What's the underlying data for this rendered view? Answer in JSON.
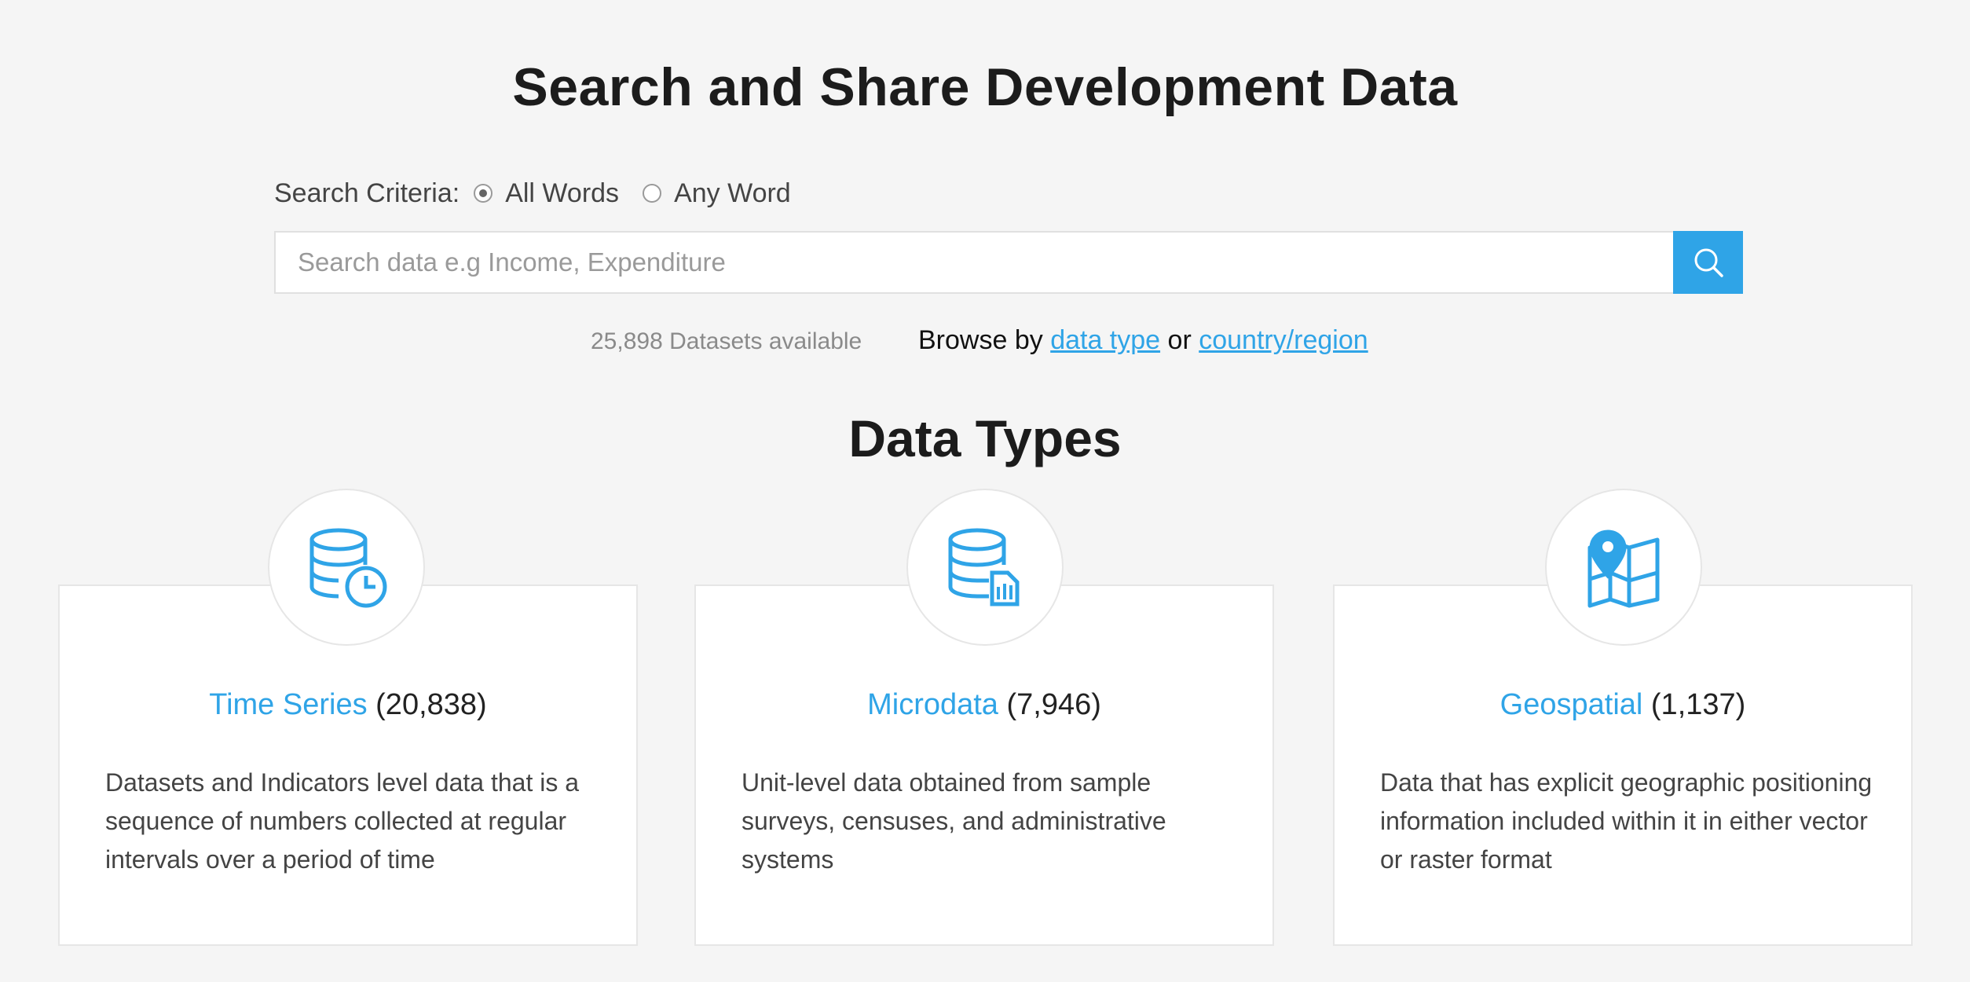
{
  "header": {
    "title": "Search and Share Development Data"
  },
  "search": {
    "criteria_label": "Search Criteria:",
    "options": [
      {
        "label": "All Words",
        "checked": true
      },
      {
        "label": "Any Word",
        "checked": false
      }
    ],
    "placeholder": "Search data e.g Income, Expenditure",
    "value": "",
    "button_icon": "search-icon"
  },
  "info": {
    "dataset_count": "25,898 Datasets available",
    "browse_prefix": "Browse by",
    "link_data_type": "data type",
    "browse_or": "or",
    "link_country_region": "country/region"
  },
  "data_types": {
    "title": "Data Types",
    "cards": [
      {
        "name": "Time Series",
        "count": "(20,838)",
        "icon": "database-clock-icon",
        "description": "Datasets and Indicators level data that is a sequence of numbers collected at regular intervals over a period of time"
      },
      {
        "name": "Microdata",
        "count": "(7,946)",
        "icon": "database-file-icon",
        "description": "Unit-level data obtained from sample surveys, censuses, and administrative systems"
      },
      {
        "name": "Geospatial",
        "count": "(1,137)",
        "icon": "map-pin-icon",
        "description": "Data that has explicit geographic positioning information included within it in either vector or raster format"
      }
    ]
  },
  "colors": {
    "accent": "#2fa4e7",
    "background": "#f5f5f5",
    "card_border": "#e6e6e6"
  }
}
